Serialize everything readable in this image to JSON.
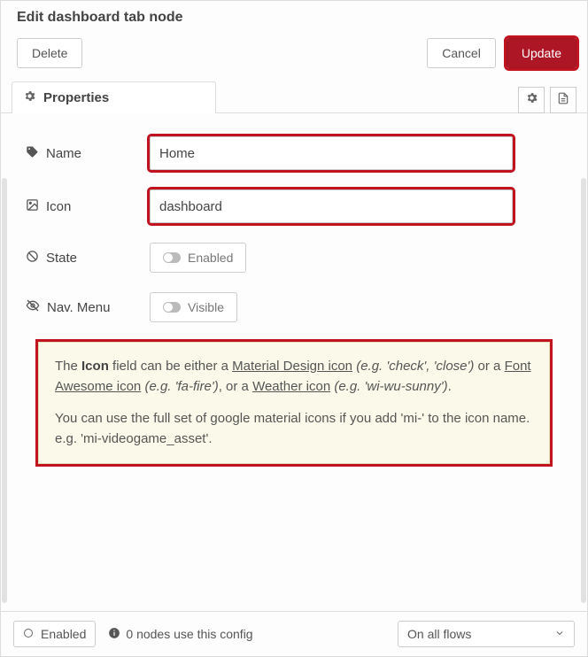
{
  "header": {
    "title": "Edit dashboard tab node"
  },
  "buttons": {
    "delete": "Delete",
    "cancel": "Cancel",
    "update": "Update"
  },
  "tabs": {
    "properties": "Properties"
  },
  "form": {
    "name": {
      "label": "Name",
      "value": "Home"
    },
    "icon": {
      "label": "Icon",
      "value": "dashboard"
    },
    "state": {
      "label": "State",
      "toggle": "Enabled"
    },
    "nav": {
      "label": "Nav. Menu",
      "toggle": "Visible"
    }
  },
  "tip": {
    "p1a": "The ",
    "p1b": "Icon",
    "p1c": " field can be either a ",
    "p1d": "Material Design icon",
    "p1e": " (e.g. 'check', 'close')",
    "p1f": " or a ",
    "p1g": "Font Awesome icon",
    "p1h": " (e.g. 'fa-fire')",
    "p1i": ", or a ",
    "p1j": "Weather icon",
    "p1k": " (e.g. 'wi-wu-sunny')",
    "p1l": ".",
    "p2": "You can use the full set of google material icons if you add 'mi-' to the icon name. e.g. 'mi-videogame_asset'."
  },
  "footer": {
    "enabled": "Enabled",
    "usage": "0 nodes use this config",
    "scope": "On all flows"
  }
}
